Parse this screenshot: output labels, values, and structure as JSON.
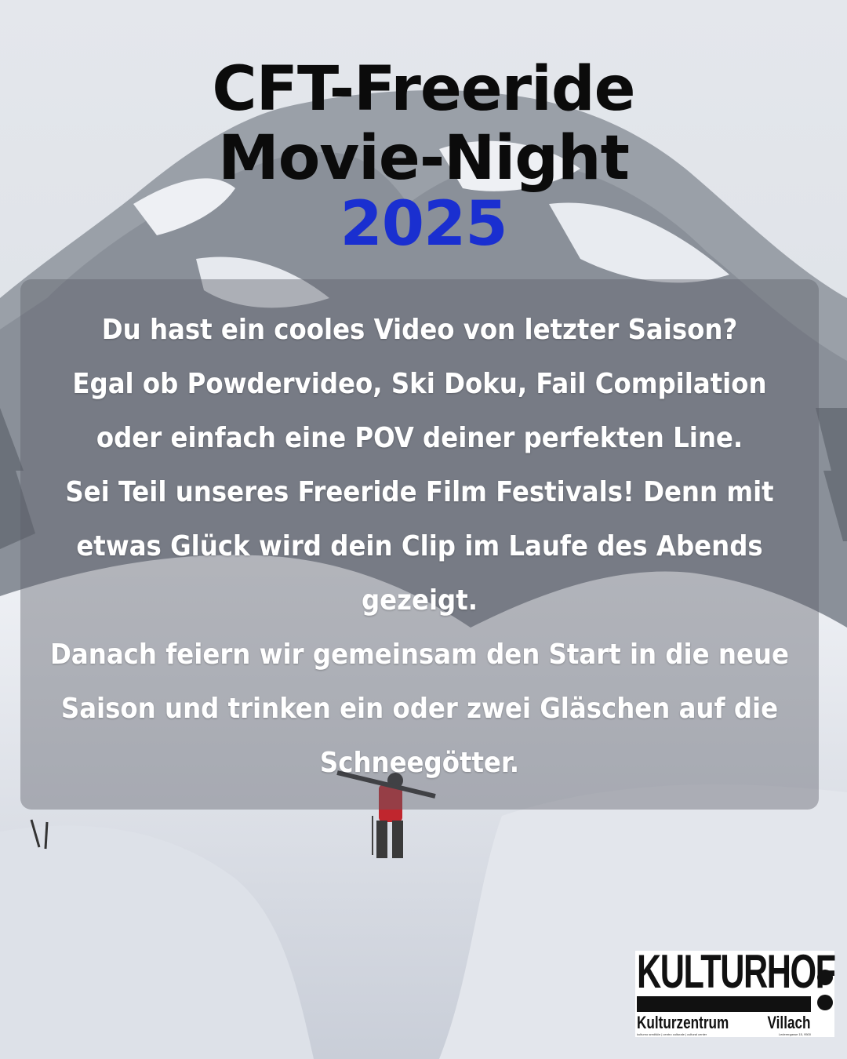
{
  "title": {
    "line1": "CFT-Freeride",
    "line2": "Movie-Night",
    "year": "2025"
  },
  "body": {
    "lines": [
      "Du hast ein cooles Video von letzter Saison?",
      "Egal ob Powdervideo, Ski Doku, Fail Compilation",
      "oder einfach eine POV deiner perfekten Line.",
      "Sei Teil unseres Freeride Film Festivals! Denn mit",
      "etwas Glück wird dein Clip im Laufe des Abends",
      "gezeigt.",
      "Danach feiern wir gemeinsam den Start in die neue",
      "Saison und trinken ein oder zwei Gläschen auf die",
      "Schneegötter."
    ]
  },
  "logo": {
    "name": "KULTURHOF",
    "subtitle_left": "Kulturzentrum",
    "subtitle_right": "Villach",
    "tiny_left": "kulturno središče | centro culturale | cultural center",
    "tiny_right": "Lederergasse 15, 9500"
  },
  "colors": {
    "title": "#0b0b0b",
    "year": "#1a2fd0",
    "body_text": "#ffffff",
    "panel": "rgba(92,96,104,0.42)"
  }
}
